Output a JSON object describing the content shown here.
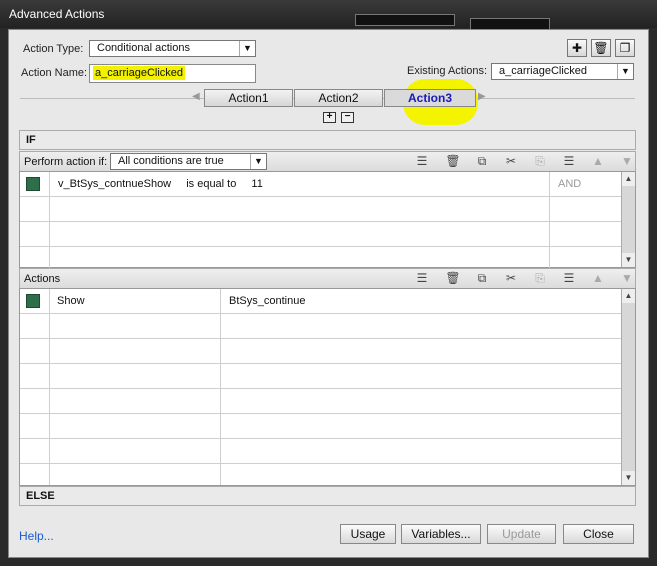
{
  "window": {
    "title": "Advanced Actions"
  },
  "action_type": {
    "label": "Action Type:",
    "value": "Conditional actions"
  },
  "action_name": {
    "label": "Action Name:",
    "value": "a_carriageClicked"
  },
  "existing_actions": {
    "label": "Existing Actions:",
    "value": "a_carriageClicked"
  },
  "top_icons": [
    "plus-icon",
    "trash-icon",
    "duplicate-icon"
  ],
  "tabs": [
    {
      "label": "Action1",
      "active": false
    },
    {
      "label": "Action2",
      "active": false
    },
    {
      "label": "Action3",
      "active": true
    }
  ],
  "if_section": {
    "header": "IF",
    "perform_label": "Perform action if:",
    "perform_value": "All conditions are true",
    "rows": [
      {
        "variable": "v_BtSys_contnueShow",
        "operator": "is equal to",
        "value": "11",
        "connector": "AND"
      }
    ]
  },
  "actions_section": {
    "header": "Actions",
    "rows": [
      {
        "action": "Show",
        "target": "BtSys_continue"
      }
    ]
  },
  "else_section": {
    "header": "ELSE"
  },
  "footer": {
    "help": "Help...",
    "buttons": {
      "usage": "Usage",
      "variables": "Variables...",
      "update": "Update",
      "close": "Close"
    }
  },
  "colors": {
    "highlight": "#f2f200",
    "condition_square": "#2f6e4a",
    "active_tab_text": "#1a1ab8"
  }
}
